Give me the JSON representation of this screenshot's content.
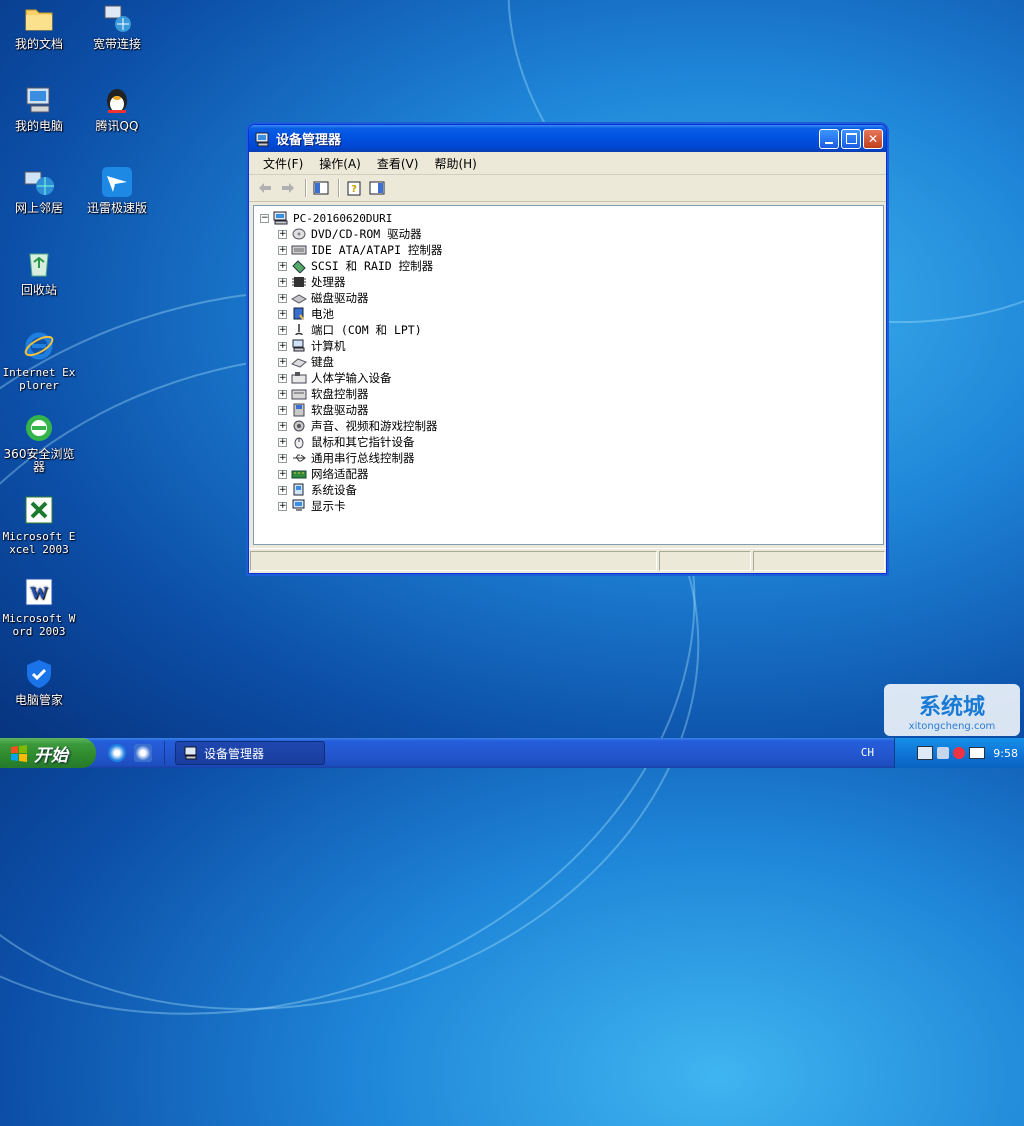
{
  "desktop": {
    "icons": [
      {
        "label": "我的文档"
      },
      {
        "label": "宽带连接"
      },
      {
        "label": "我的电脑"
      },
      {
        "label": "腾讯QQ"
      },
      {
        "label": "网上邻居"
      },
      {
        "label": "迅雷极速版"
      },
      {
        "label": "回收站"
      },
      {
        "label": "Internet Explorer"
      },
      {
        "label": "360安全浏览器"
      },
      {
        "label": "Microsoft Excel 2003"
      },
      {
        "label": "Microsoft Word 2003"
      },
      {
        "label": "电脑管家"
      }
    ]
  },
  "window": {
    "title": "设备管理器",
    "icon": "computer-icon",
    "menu": [
      "文件(F)",
      "操作(A)",
      "查看(V)",
      "帮助(H)"
    ],
    "toolbar_icons": [
      "back-arrow-icon",
      "forward-arrow-icon",
      "show-hide-console-tree-icon",
      "properties-help-icon",
      "show-hide-action-pane-icon"
    ],
    "tree": {
      "root": "PC-20160620DURI",
      "expander_collapsed": "+",
      "expander_expanded": "−",
      "nodes": [
        {
          "label": "DVD/CD-ROM 驱动器",
          "icon": "cd-drive-icon"
        },
        {
          "label": "IDE ATA/ATAPI 控制器",
          "icon": "ide-controller-icon"
        },
        {
          "label": "SCSI 和 RAID 控制器",
          "icon": "scsi-controller-icon"
        },
        {
          "label": "处理器",
          "icon": "processor-icon"
        },
        {
          "label": "磁盘驱动器",
          "icon": "disk-drive-icon"
        },
        {
          "label": "电池",
          "icon": "battery-icon"
        },
        {
          "label": "端口 (COM 和 LPT)",
          "icon": "port-icon"
        },
        {
          "label": "计算机",
          "icon": "computer-icon"
        },
        {
          "label": "键盘",
          "icon": "keyboard-icon"
        },
        {
          "label": "人体学输入设备",
          "icon": "hid-icon"
        },
        {
          "label": "软盘控制器",
          "icon": "floppy-controller-icon"
        },
        {
          "label": "软盘驱动器",
          "icon": "floppy-drive-icon"
        },
        {
          "label": "声音、视频和游戏控制器",
          "icon": "sound-icon"
        },
        {
          "label": "鼠标和其它指针设备",
          "icon": "mouse-icon"
        },
        {
          "label": "通用串行总线控制器",
          "icon": "usb-icon"
        },
        {
          "label": "网络适配器",
          "icon": "network-adapter-icon"
        },
        {
          "label": "系统设备",
          "icon": "system-device-icon"
        },
        {
          "label": "显示卡",
          "icon": "display-adapter-icon"
        }
      ]
    }
  },
  "taskbar": {
    "start_label": "开始",
    "task_label": "设备管理器",
    "language": "CH",
    "clock": "9:58"
  },
  "watermark": {
    "line1": "系统城",
    "line2": "xitongcheng.com"
  }
}
